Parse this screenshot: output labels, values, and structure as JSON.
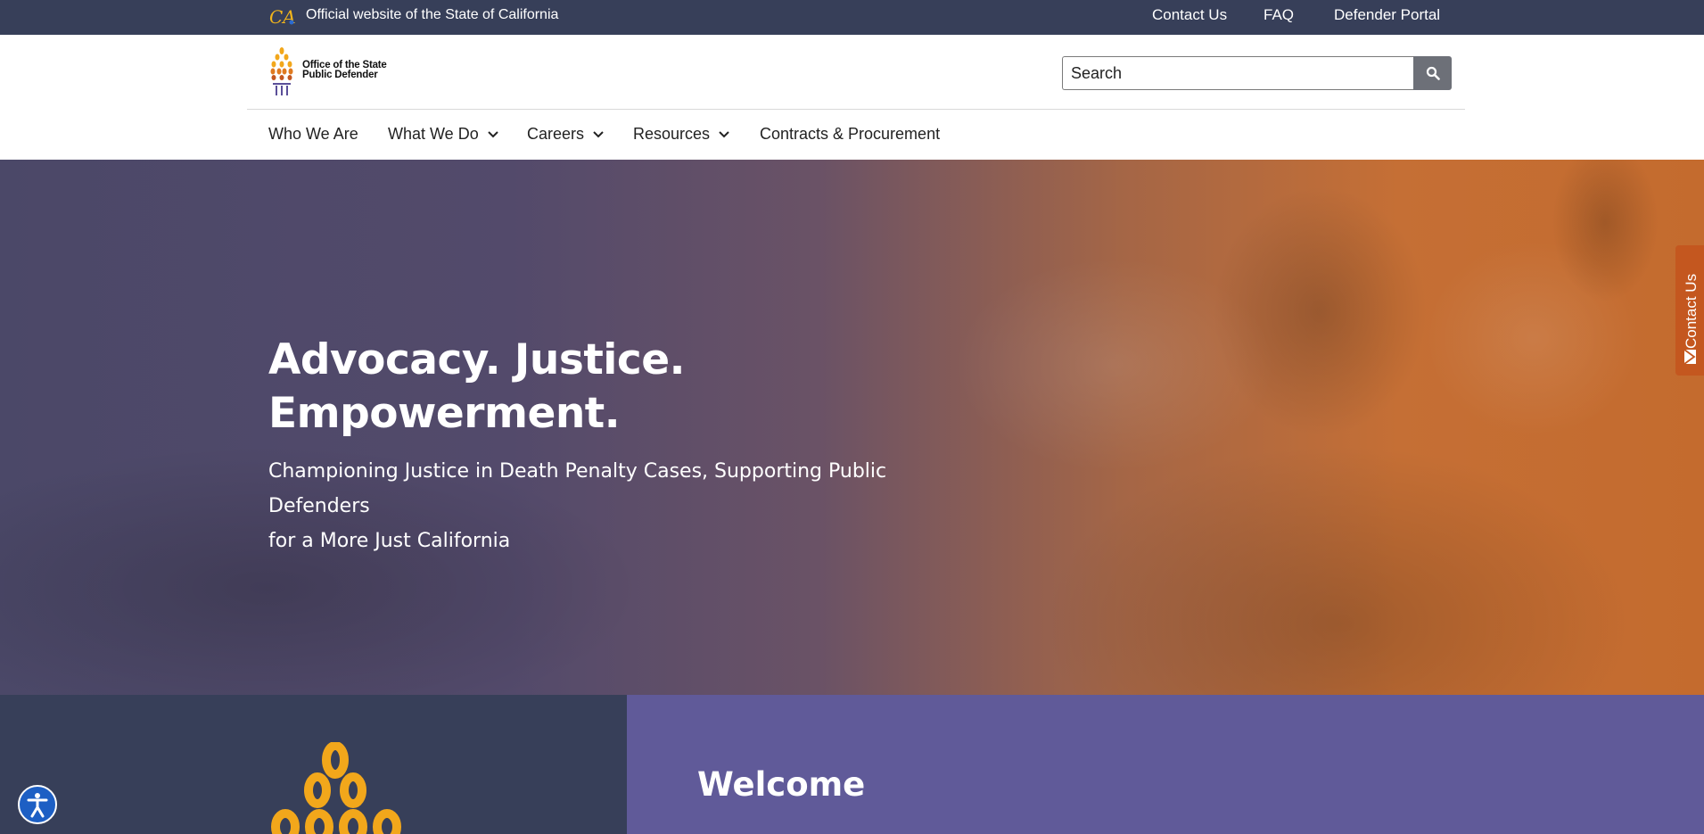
{
  "utility_bar": {
    "official_text": "Official website of the State of California",
    "links": [
      "Contact Us",
      "FAQ",
      "Defender Portal"
    ]
  },
  "header": {
    "brand_line1": "Office of the State",
    "brand_line2": "Public Defender",
    "search_placeholder": "Search"
  },
  "nav": {
    "items": [
      {
        "label": "Who We Are",
        "dropdown": false
      },
      {
        "label": "What We Do",
        "dropdown": true
      },
      {
        "label": "Careers",
        "dropdown": true
      },
      {
        "label": "Resources",
        "dropdown": true
      },
      {
        "label": "Contracts & Procurement",
        "dropdown": false
      }
    ]
  },
  "hero": {
    "title_line1": "Advocacy. Justice.",
    "title_line2": "Empowerment.",
    "subtitle_line1": "Championing Justice in Death Penalty Cases, Supporting Public Defenders",
    "subtitle_line2": "for a More Just California"
  },
  "contact_tab": {
    "label": "Contact Us"
  },
  "welcome": {
    "heading": "Welcome"
  },
  "colors": {
    "utility_bg": "#373f59",
    "accent_purple": "#605a99",
    "accent_orange": "#c4571f",
    "gold": "#f2a71b"
  }
}
